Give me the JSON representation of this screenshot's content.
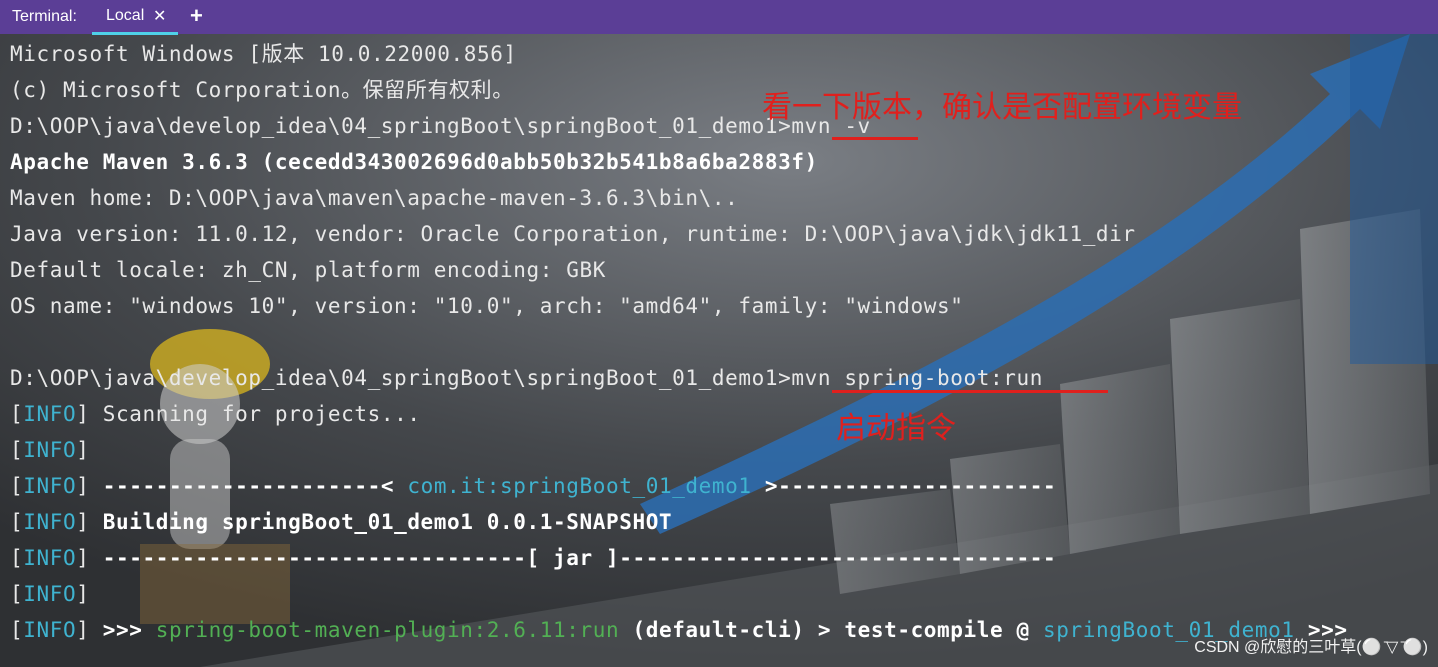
{
  "tabbar": {
    "title": "Terminal:",
    "tab_label": "Local",
    "close_glyph": "✕",
    "add_glyph": "+"
  },
  "lines": {
    "l1": "Microsoft Windows [版本 10.0.22000.856]",
    "l2": "(c) Microsoft Corporation。保留所有权利。",
    "l3_prompt": "D:\\OOP\\java\\develop_idea\\04_springBoot\\springBoot_01_demo1>",
    "l3_cmd": "mvn -v",
    "l4": "Apache Maven 3.6.3 (cecedd343002696d0abb50b32b541b8a6ba2883f)",
    "l5": "Maven home: D:\\OOP\\java\\maven\\apache-maven-3.6.3\\bin\\..",
    "l6": "Java version: 11.0.12, vendor: Oracle Corporation, runtime: D:\\OOP\\java\\jdk\\jdk11_dir",
    "l7": "Default locale: zh_CN, platform encoding: GBK",
    "l8": "OS name: \"windows 10\", version: \"10.0\", arch: \"amd64\", family: \"windows\"",
    "l10_prompt": "D:\\OOP\\java\\develop_idea\\04_springBoot\\springBoot_01_demo1>",
    "l10_cmd": "mvn spring-boot:run",
    "info_open": "[",
    "info_tag": "INFO",
    "info_close": "]",
    "l11_text": " Scanning for projects...",
    "l13_dash_left": " ---------------------< ",
    "l13_artifact": "com.it:springBoot_01_demo1",
    "l13_dash_right": " >---------------------",
    "l14_text": " Building springBoot_01_demo1 0.0.1-SNAPSHOT",
    "l15_text": " --------------------------------[ jar ]---------------------------------",
    "l17_arrows": " >>> ",
    "l17_plugin": "spring-boot-maven-plugin:2.6.11:run",
    "l17_mid": " (default-cli) > test-compile @ ",
    "l17_project": "springBoot_01_demo1",
    "l17_end": " >>>"
  },
  "annotations": {
    "version_note": "看一下版本，确认是否配置环境变量",
    "run_note": "启动指令"
  },
  "watermark": "CSDN @欣慰的三叶草(⚪ ̄▽ ̄⚪)",
  "colors": {
    "tabbar": "#5b3e96",
    "tab_underline": "#4fd1e8",
    "info": "#3fb3d0",
    "plugin_green": "#52b054",
    "annotation_red": "#e0201d"
  }
}
